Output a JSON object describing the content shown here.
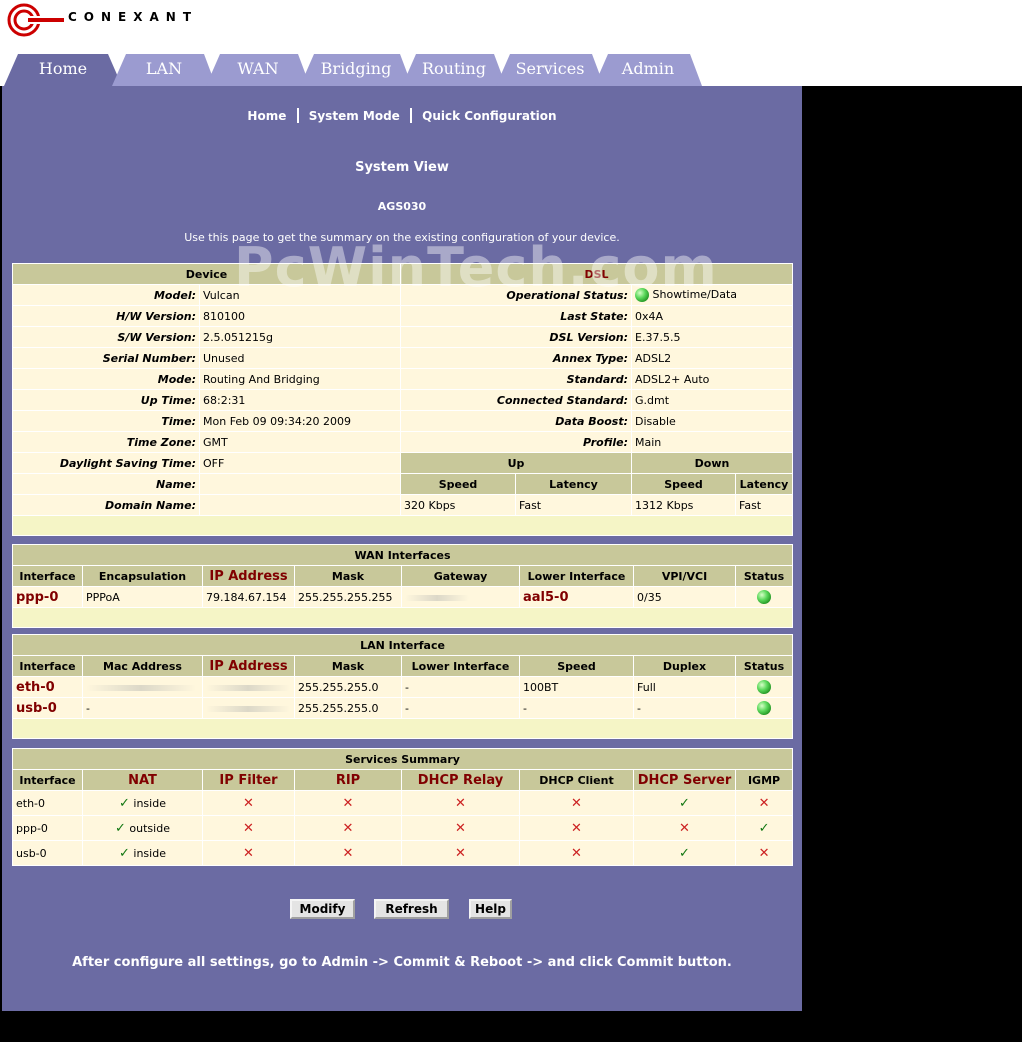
{
  "brand": "CONEXANT",
  "tabs": [
    {
      "label": "Home",
      "active": true
    },
    {
      "label": "LAN"
    },
    {
      "label": "WAN"
    },
    {
      "label": "Bridging"
    },
    {
      "label": "Routing"
    },
    {
      "label": "Services"
    },
    {
      "label": "Admin"
    }
  ],
  "subnav": [
    "Home",
    "System Mode",
    "Quick Configuration"
  ],
  "page_title": "System View",
  "model_title": "AGS030",
  "description": "Use this page to get the summary on the existing configuration of your device.",
  "watermark": "PcWinTech.com",
  "device": {
    "heading": "Device",
    "rows": [
      {
        "label": "Model:",
        "value": "Vulcan"
      },
      {
        "label": "H/W Version:",
        "value": "810100"
      },
      {
        "label": "S/W Version:",
        "value": "2.5.051215g"
      },
      {
        "label": "Serial Number:",
        "value": "Unused"
      },
      {
        "label": "Mode:",
        "value": "Routing And Bridging"
      },
      {
        "label": "Up Time:",
        "value": "68:2:31"
      },
      {
        "label": "Time:",
        "value": "Mon Feb 09 09:34:20 2009"
      },
      {
        "label": "Time Zone:",
        "value": "GMT"
      },
      {
        "label": "Daylight Saving Time:",
        "value": "OFF"
      },
      {
        "label": "Name:",
        "value": ""
      },
      {
        "label": "Domain Name:",
        "value": ""
      }
    ]
  },
  "dsl": {
    "heading": "DSL",
    "rows": [
      {
        "label": "Operational Status:",
        "value": "Showtime/Data"
      },
      {
        "label": "Last State:",
        "value": "0x4A"
      },
      {
        "label": "DSL Version:",
        "value": "E.37.5.5"
      },
      {
        "label": "Annex Type:",
        "value": "ADSL2"
      },
      {
        "label": "Standard:",
        "value": "ADSL2+ Auto"
      },
      {
        "label": "Connected Standard:",
        "value": "G.dmt"
      },
      {
        "label": "Data Boost:",
        "value": "Disable"
      },
      {
        "label": "Profile:",
        "value": "Main"
      }
    ],
    "up": "Up",
    "down": "Down",
    "speed": "Speed",
    "latency": "Latency",
    "up_speed": "320 Kbps",
    "up_latency": "Fast",
    "down_speed": "1312 Kbps",
    "down_latency": "Fast"
  },
  "wan": {
    "heading": "WAN Interfaces",
    "headers": [
      "Interface",
      "Encapsulation",
      "IP Address",
      "Mask",
      "Gateway",
      "Lower Interface",
      "VPI/VCI",
      "Status"
    ],
    "rows": [
      {
        "iface": "ppp-0",
        "encap": "PPPoA",
        "ip": "79.184.67.154",
        "mask": "255.255.255.255",
        "gateway": "",
        "lower": "aal5-0",
        "vpivci": "0/35"
      }
    ]
  },
  "lan": {
    "heading": "LAN Interface",
    "headers": [
      "Interface",
      "Mac Address",
      "IP Address",
      "Mask",
      "Lower Interface",
      "Speed",
      "Duplex",
      "Status"
    ],
    "rows": [
      {
        "iface": "eth-0",
        "mac": "",
        "ip": "",
        "mask": "255.255.255.0",
        "lower": "-",
        "speed": "100BT",
        "duplex": "Full"
      },
      {
        "iface": "usb-0",
        "mac": "-",
        "ip": "",
        "mask": "255.255.255.0",
        "lower": "-",
        "speed": "-",
        "duplex": "-"
      }
    ]
  },
  "services": {
    "heading": "Services Summary",
    "headers": [
      "Interface",
      "NAT",
      "IP Filter",
      "RIP",
      "DHCP Relay",
      "DHCP Client",
      "DHCP Server",
      "IGMP"
    ],
    "rows": [
      {
        "iface": "eth-0",
        "nat": "inside",
        "ipfilter": false,
        "rip": false,
        "relay": false,
        "client": false,
        "server": true,
        "igmp": false
      },
      {
        "iface": "ppp-0",
        "nat": "outside",
        "ipfilter": false,
        "rip": false,
        "relay": false,
        "client": false,
        "server": false,
        "igmp": true
      },
      {
        "iface": "usb-0",
        "nat": "inside",
        "ipfilter": false,
        "rip": false,
        "relay": false,
        "client": false,
        "server": true,
        "igmp": false
      }
    ]
  },
  "buttons": {
    "modify": "Modify",
    "refresh": "Refresh",
    "help": "Help"
  },
  "footer": "After configure all settings, go to Admin -> Commit & Reboot -> and click Commit button.",
  "colors": {
    "panel": "#6b6ba3",
    "header": "#c8c89a",
    "cell": "#fff7dd",
    "accent": "#800000"
  }
}
